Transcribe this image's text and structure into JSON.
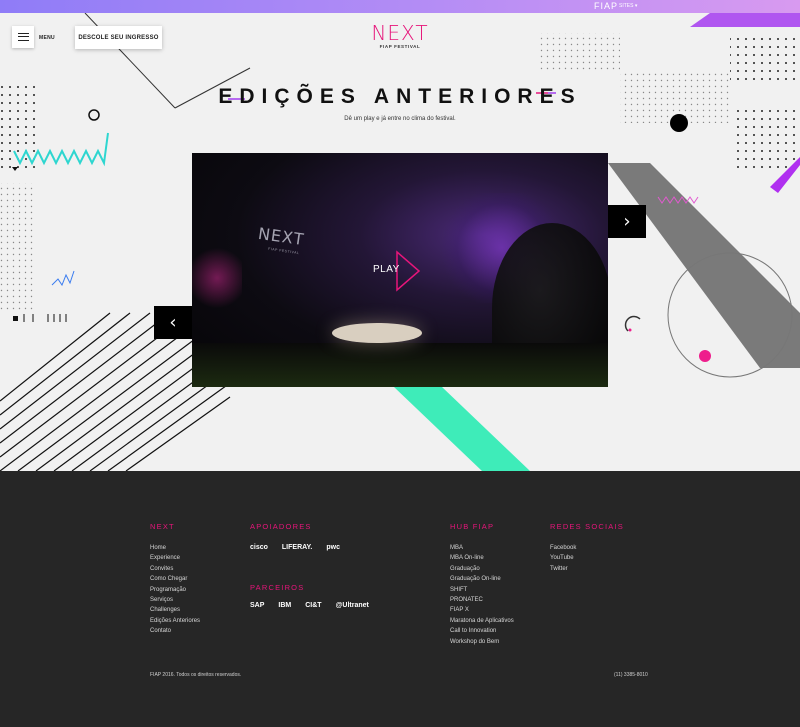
{
  "topbar": {
    "brand": "FIAP",
    "sites_label": "SITES ▾"
  },
  "header": {
    "menu_label": "MENU",
    "ticket_button": "DESCOLE SEU INGRESSO",
    "logo_main": "NEXT",
    "logo_sub": "FIAP FESTIVAL"
  },
  "hero": {
    "title": "EDIÇÕES ANTERIORES",
    "subtitle": "Dê um play e já entre no clima do festival."
  },
  "video": {
    "logo_main": "NEXT",
    "logo_sub": "FIAP FESTIVAL",
    "play_label": "PLAY",
    "prev_icon": "chevron-left-icon",
    "next_icon": "chevron-right-icon"
  },
  "footer": {
    "next": {
      "title": "NEXT",
      "links": [
        "Home",
        "Experience",
        "Convites",
        "Como Chegar",
        "Programação",
        "Serviços",
        "Challenges",
        "Edições Anteriores",
        "Contato"
      ]
    },
    "supporters": {
      "title": "APOIADORES",
      "logos": [
        "cisco",
        "LIFERAY.",
        "pwc"
      ]
    },
    "partners": {
      "title": "PARCEIROS",
      "logos": [
        "SAP",
        "IBM",
        "CI&T",
        "@Ultranet"
      ]
    },
    "hub": {
      "title": "HUB FIAP",
      "links": [
        "MBA",
        "MBA On-line",
        "Graduação",
        "Graduação On-line",
        "SHIFT",
        "PRONATEC",
        "FIAP X",
        "Maratona de Aplicativos",
        "Call to Innovation",
        "Workshop do Bem"
      ]
    },
    "social": {
      "title": "REDES SOCIAIS",
      "links": [
        "Facebook",
        "YouTube",
        "Twitter"
      ]
    },
    "copyright": "FIAP 2016. Todos os direitos reservados.",
    "phone": "(11) 3385-8010"
  },
  "colors": {
    "accent": "#e6157a",
    "teal": "#3eecb9",
    "purple": "#a23cf0",
    "footer_bg": "#262626"
  }
}
